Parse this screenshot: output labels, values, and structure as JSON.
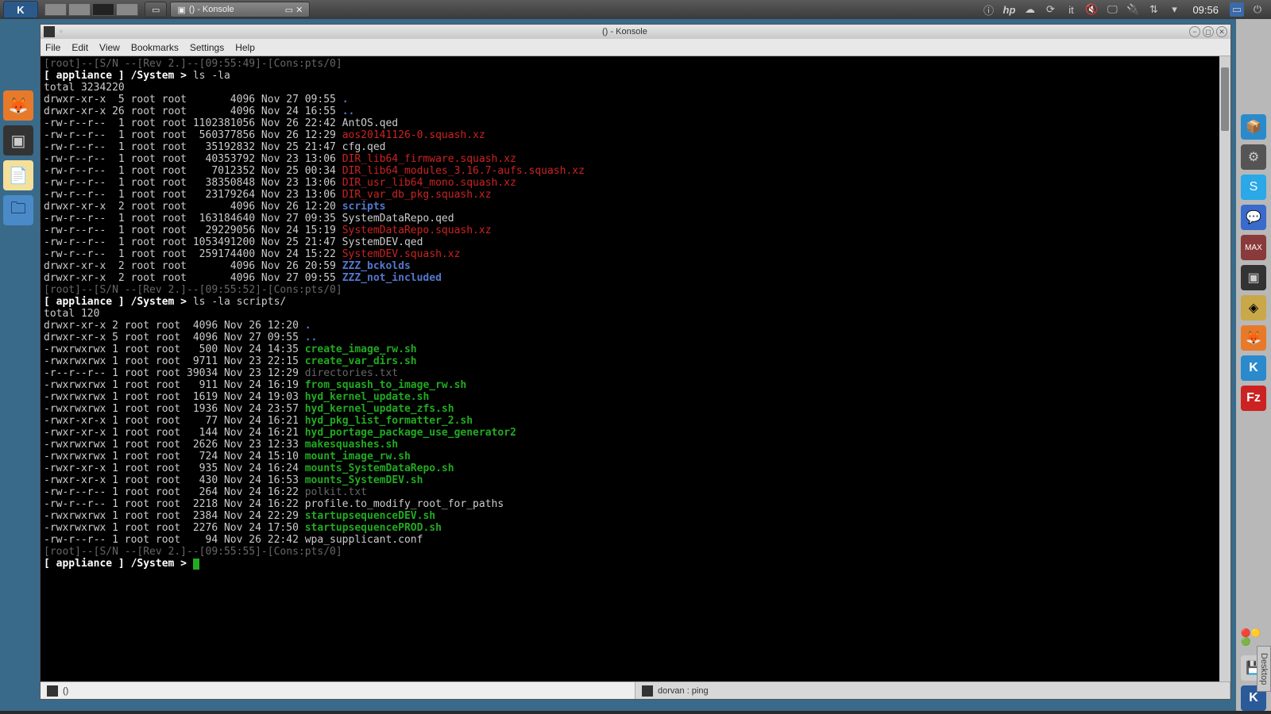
{
  "top_panel": {
    "taskbar": [
      {
        "icon": "▭",
        "label": ""
      },
      {
        "icon": "▣",
        "label": "() - Konsole",
        "active": true
      }
    ],
    "tray": {
      "lang": "it",
      "clock": "09:56"
    }
  },
  "window": {
    "title": "() - Konsole",
    "menubar": [
      "File",
      "Edit",
      "View",
      "Bookmarks",
      "Settings",
      "Help"
    ],
    "tabs": [
      {
        "label": "()",
        "active": true
      },
      {
        "label": "dorvan : ping",
        "active": false
      }
    ]
  },
  "terminal": {
    "status1": "[root]--[S/N --[Rev 2.]--[09:55:49]-[Cons:pts/0]",
    "prompt": "[ appliance ] /System > ",
    "cmd1": "ls -la",
    "total1": "total 3234220",
    "listing1": [
      {
        "p": "drwxr-xr-x  5 root root       4096 Nov 27 09:55 ",
        "n": ".",
        "c": "blu"
      },
      {
        "p": "drwxr-xr-x 26 root root       4096 Nov 24 16:55 ",
        "n": "..",
        "c": "blu"
      },
      {
        "p": "-rw-r--r--  1 root root 1102381056 Nov 26 22:42 ",
        "n": "AntOS.qed",
        "c": ""
      },
      {
        "p": "-rw-r--r--  1 root root  560377856 Nov 26 12:29 ",
        "n": "aos20141126-0.squash.xz",
        "c": "red"
      },
      {
        "p": "-rw-r--r--  1 root root   35192832 Nov 25 21:47 ",
        "n": "cfg.qed",
        "c": ""
      },
      {
        "p": "-rw-r--r--  1 root root   40353792 Nov 23 13:06 ",
        "n": "DIR_lib64_firmware.squash.xz",
        "c": "red"
      },
      {
        "p": "-rw-r--r--  1 root root    7012352 Nov 25 00:34 ",
        "n": "DIR_lib64_modules_3.16.7-aufs.squash.xz",
        "c": "red"
      },
      {
        "p": "-rw-r--r--  1 root root   38350848 Nov 23 13:06 ",
        "n": "DIR_usr_lib64_mono.squash.xz",
        "c": "red"
      },
      {
        "p": "-rw-r--r--  1 root root   23179264 Nov 23 13:06 ",
        "n": "DIR_var_db_pkg.squash.xz",
        "c": "red"
      },
      {
        "p": "drwxr-xr-x  2 root root       4096 Nov 26 12:20 ",
        "n": "scripts",
        "c": "blu"
      },
      {
        "p": "-rw-r--r--  1 root root  163184640 Nov 27 09:35 ",
        "n": "SystemDataRepo.qed",
        "c": ""
      },
      {
        "p": "-rw-r--r--  1 root root   29229056 Nov 24 15:19 ",
        "n": "SystemDataRepo.squash.xz",
        "c": "red"
      },
      {
        "p": "-rw-r--r--  1 root root 1053491200 Nov 25 21:47 ",
        "n": "SystemDEV.qed",
        "c": ""
      },
      {
        "p": "-rw-r--r--  1 root root  259174400 Nov 24 15:22 ",
        "n": "SystemDEV.squash.xz",
        "c": "red"
      },
      {
        "p": "drwxr-xr-x  2 root root       4096 Nov 26 20:59 ",
        "n": "ZZZ_bckolds",
        "c": "blu"
      },
      {
        "p": "drwxr-xr-x  2 root root       4096 Nov 27 09:55 ",
        "n": "ZZZ_not_included",
        "c": "blu"
      }
    ],
    "status2": "[root]--[S/N --[Rev 2.]--[09:55:52]-[Cons:pts/0]",
    "cmd2": "ls -la scripts/",
    "total2": "total 120",
    "listing2": [
      {
        "p": "drwxr-xr-x 2 root root  4096 Nov 26 12:20 ",
        "n": ".",
        "c": "blu"
      },
      {
        "p": "drwxr-xr-x 5 root root  4096 Nov 27 09:55 ",
        "n": "..",
        "c": "blu"
      },
      {
        "p": "-rwxrwxrwx 1 root root   500 Nov 24 14:35 ",
        "n": "create_image_rw.sh",
        "c": "grn"
      },
      {
        "p": "-rwxrwxrwx 1 root root  9711 Nov 23 22:15 ",
        "n": "create_var_dirs.sh",
        "c": "grn"
      },
      {
        "p": "-r--r--r-- 1 root root 39034 Nov 23 12:29 ",
        "n": "directories.txt",
        "c": "dim"
      },
      {
        "p": "-rwxrwxrwx 1 root root   911 Nov 24 16:19 ",
        "n": "from_squash_to_image_rw.sh",
        "c": "grn"
      },
      {
        "p": "-rwxrwxrwx 1 root root  1619 Nov 24 19:03 ",
        "n": "hyd_kernel_update.sh",
        "c": "grn"
      },
      {
        "p": "-rwxrwxrwx 1 root root  1936 Nov 24 23:57 ",
        "n": "hyd_kernel_update_zfs.sh",
        "c": "grn"
      },
      {
        "p": "-rwxr-xr-x 1 root root    77 Nov 24 16:21 ",
        "n": "hyd_pkg_list_formatter_2.sh",
        "c": "grn"
      },
      {
        "p": "-rwxr-xr-x 1 root root   144 Nov 24 16:21 ",
        "n": "hyd_portage_package_use_generator2",
        "c": "grn"
      },
      {
        "p": "-rwxrwxrwx 1 root root  2626 Nov 23 12:33 ",
        "n": "makesquashes.sh",
        "c": "grn"
      },
      {
        "p": "-rwxrwxrwx 1 root root   724 Nov 24 15:10 ",
        "n": "mount_image_rw.sh",
        "c": "grn"
      },
      {
        "p": "-rwxr-xr-x 1 root root   935 Nov 24 16:24 ",
        "n": "mounts_SystemDataRepo.sh",
        "c": "grn"
      },
      {
        "p": "-rwxr-xr-x 1 root root   430 Nov 24 16:53 ",
        "n": "mounts_SystemDEV.sh",
        "c": "grn"
      },
      {
        "p": "-rw-r--r-- 1 root root   264 Nov 24 16:22 ",
        "n": "polkit.txt",
        "c": "dim"
      },
      {
        "p": "-rw-r--r-- 1 root root  2218 Nov 24 16:22 ",
        "n": "profile.to_modify_root_for_paths",
        "c": ""
      },
      {
        "p": "-rwxrwxrwx 1 root root  2384 Nov 24 22:29 ",
        "n": "startupsequenceDEV.sh",
        "c": "grn"
      },
      {
        "p": "-rwxrwxrwx 1 root root  2276 Nov 24 17:50 ",
        "n": "startupsequencePROD.sh",
        "c": "grn"
      },
      {
        "p": "-rw-r--r-- 1 root root    94 Nov 26 22:42 ",
        "n": "wpa_supplicant.conf",
        "c": ""
      }
    ],
    "status3": "[root]--[S/N --[Rev 2.]--[09:55:55]-[Cons:pts/0]"
  },
  "right_dock_label": "Desktop"
}
